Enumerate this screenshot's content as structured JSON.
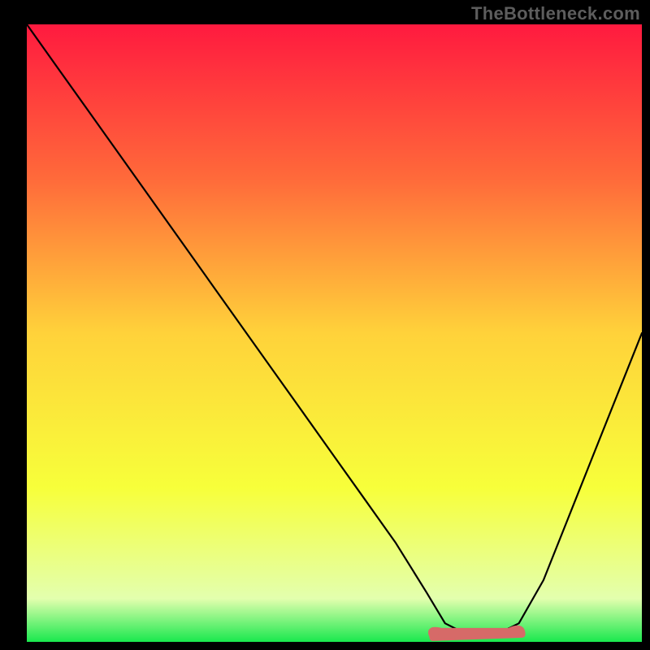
{
  "watermark": "TheBottleneck.com",
  "chart_data": {
    "type": "line",
    "title": "",
    "xlabel": "",
    "ylabel": "",
    "xlim": [
      0,
      100
    ],
    "ylim": [
      0,
      100
    ],
    "optimal_range": {
      "x_start": 66,
      "x_end": 80,
      "marker_color": "#d66a68"
    },
    "curve": {
      "x": [
        0,
        5,
        10,
        15,
        20,
        25,
        30,
        35,
        40,
        45,
        50,
        55,
        60,
        65,
        68,
        72,
        76,
        80,
        84,
        88,
        92,
        96,
        100
      ],
      "y": [
        100,
        93,
        86,
        79,
        72,
        65,
        58,
        51,
        44,
        37,
        30,
        23,
        16,
        8,
        3,
        1,
        1,
        3,
        10,
        20,
        30,
        40,
        50
      ]
    },
    "background_gradient": {
      "type": "vertical",
      "stops": [
        {
          "offset": 0.0,
          "color": "#ff1a3f"
        },
        {
          "offset": 0.25,
          "color": "#ff6a3a"
        },
        {
          "offset": 0.5,
          "color": "#ffd23a"
        },
        {
          "offset": 0.75,
          "color": "#f7ff3a"
        },
        {
          "offset": 0.93,
          "color": "#e3ffae"
        },
        {
          "offset": 1.0,
          "color": "#19e84e"
        }
      ]
    }
  }
}
